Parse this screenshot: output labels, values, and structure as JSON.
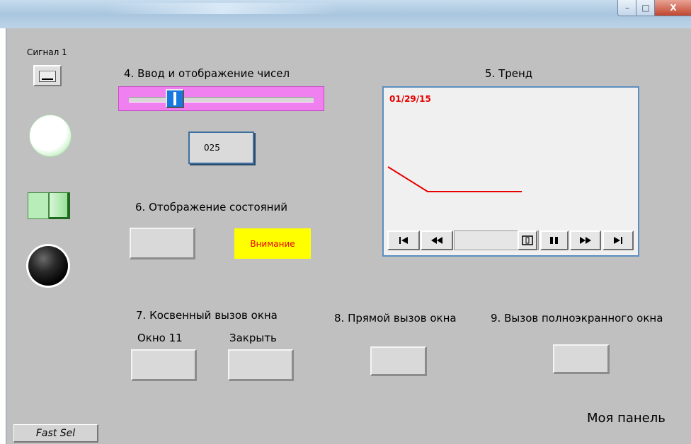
{
  "window": {
    "minimize_glyph": "–",
    "maximize_glyph": "□",
    "close_glyph": "X"
  },
  "signal": {
    "label": "Сигнал 1",
    "button_glyph": "—"
  },
  "section4": {
    "title": "4. Ввод и отображение чисел",
    "value": "025",
    "slider_position": 0.23
  },
  "section5": {
    "title": "5. Тренд",
    "date": "01/29/15",
    "trend_color": "#e60000"
  },
  "section6": {
    "title": "6. Отображение состояний",
    "warning_label": "Внимание",
    "warning_color": "#ffff00"
  },
  "section7": {
    "title": "7. Косвенный вызов окна",
    "window_label": "Окно 11",
    "close_label": "Закрыть"
  },
  "section8": {
    "title": "8. Прямой вызов окна"
  },
  "section9": {
    "title": "9. Вызов полноэкранного окна"
  },
  "panel_name": "Моя панель",
  "fast_sel_label": "Fast Sel",
  "colors": {
    "panel_bg": "#c0c0c0",
    "slider_bg": "#f080f0",
    "toggle_green": "#a8e6a8"
  },
  "icons": {
    "trend_first": "skip-start-icon",
    "trend_rewind": "rewind-icon",
    "trend_cursor": "cursor-icon",
    "trend_pause": "pause-icon",
    "trend_forward": "fast-forward-icon",
    "trend_last": "skip-end-icon"
  }
}
